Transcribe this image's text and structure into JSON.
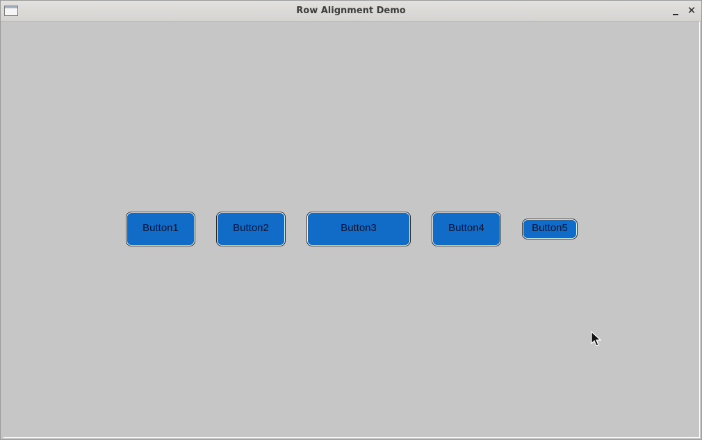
{
  "window": {
    "title": "Row Alignment Demo",
    "controls": {
      "minimize_icon": "minimize-icon",
      "close_label": "✕"
    }
  },
  "row": {
    "buttons": [
      {
        "label": "Button1"
      },
      {
        "label": "Button2"
      },
      {
        "label": "Button3"
      },
      {
        "label": "Button4"
      },
      {
        "label": "Button5"
      }
    ]
  },
  "colors": {
    "background": "#c6c6c6",
    "button_fill": "#106cc7",
    "button_border": "#2b2b2b",
    "titlebar": "#dcdad7"
  }
}
